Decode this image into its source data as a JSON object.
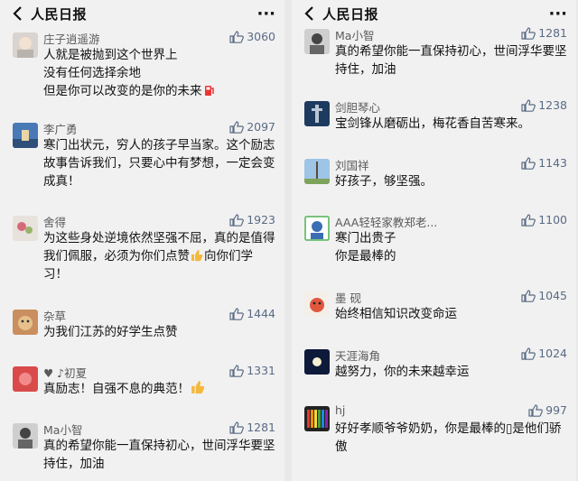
{
  "left": {
    "header": {
      "title": "人民日报",
      "more": "···"
    },
    "comments": [
      {
        "name": "庄子逍遥游",
        "likes": "3060",
        "text": "人就是被抛到这个世界上\n没有任何选择余地\n但是你可以改变的是你的未来",
        "trailing_icon": "fuel-pump-icon"
      },
      {
        "name": "李广勇",
        "likes": "2097",
        "text": "寒门出状元，穷人的孩子早当家。这个励志故事告诉我们，只要心中有梦想，一定会变成真！"
      },
      {
        "name": "舍得",
        "likes": "1923",
        "text_before": "为这些身处逆境依然坚强不屈，真的是值得我们佩服，必须为你们点赞",
        "text_after": "向你们学习！",
        "inline_icon": "thumbs-up-emoji-icon"
      },
      {
        "name": "杂草",
        "likes": "1444",
        "text": "为我们江苏的好学生点赞"
      },
      {
        "name": "♥ ♪初夏",
        "likes": "1331",
        "text": "真励志！自强不息的典范！",
        "trailing_icon": "thumbs-up-emoji-icon"
      },
      {
        "name": "Ma小智",
        "likes": "1281",
        "text": "真的希望你能一直保持初心，世间浮华要坚持住，加油"
      }
    ]
  },
  "right": {
    "header": {
      "title": "人民日报",
      "more": "···"
    },
    "comments": [
      {
        "name": "Ma小智",
        "likes": "1281",
        "text": "真的希望你能一直保持初心，世间浮华要坚持住，加油"
      },
      {
        "name": "剑胆琴心",
        "likes": "1238",
        "text": "宝剑锋从磨砺出，梅花香自苦寒来。"
      },
      {
        "name": "刘国祥",
        "likes": "1143",
        "text": "好孩子，够坚强。"
      },
      {
        "name": "AAA轻轻家教郑老...",
        "likes": "1100",
        "text": "寒门出贵子\n你是最棒的"
      },
      {
        "name": "墨 砚",
        "likes": "1045",
        "text": "始终相信知识改变命运"
      },
      {
        "name": "天涯海角",
        "likes": "1024",
        "text": "越努力，你的未来越幸运"
      },
      {
        "name": "hj",
        "likes": "997",
        "text": "好好孝顺爷爷奶奶，你是最棒的▯是他们骄傲"
      }
    ]
  },
  "colors": {
    "background": "#f1f1f1",
    "like_count": "#5a6a84",
    "name": "#5a5a5a",
    "text": "#111111"
  }
}
